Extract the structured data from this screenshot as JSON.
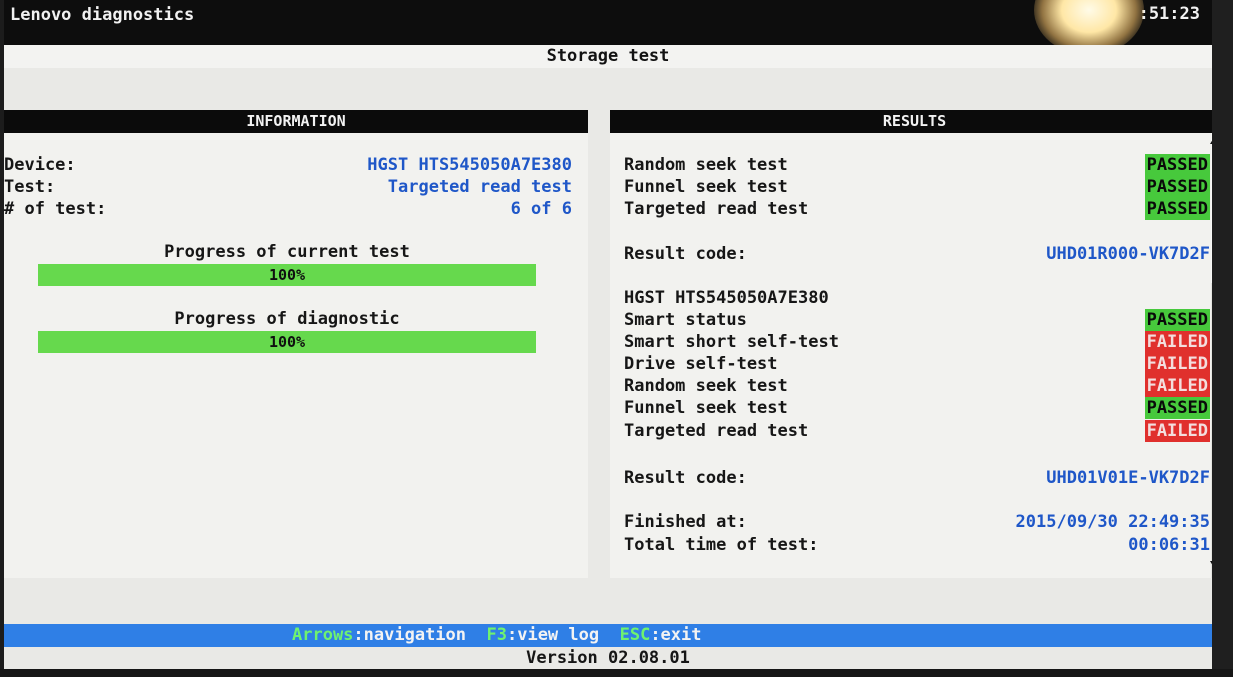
{
  "app": {
    "title": "Lenovo diagnostics",
    "clock": ":51:23"
  },
  "screen": {
    "title": "Storage test"
  },
  "information": {
    "header": "INFORMATION",
    "rows": [
      {
        "label": "Device:",
        "value": "HGST HTS545050A7E380"
      },
      {
        "label": "Test:",
        "value": "Targeted read test"
      },
      {
        "label": "# of test:",
        "value": "6 of 6"
      }
    ],
    "progress_current": {
      "label": "Progress of current test",
      "text": "100%",
      "percent": 100
    },
    "progress_diagnostic": {
      "label": "Progress of diagnostic",
      "text": "100%",
      "percent": 100
    }
  },
  "results": {
    "header": "RESULTS",
    "group1": [
      {
        "label": "Random seek test",
        "status": "PASSED"
      },
      {
        "label": "Funnel seek test",
        "status": "PASSED"
      },
      {
        "label": "Targeted read test",
        "status": "PASSED"
      }
    ],
    "result_code_1": {
      "label": "Result code:",
      "value": "UHD01R000-VK7D2F"
    },
    "device_name": "HGST HTS545050A7E380",
    "group2": [
      {
        "label": "Smart status",
        "status": "PASSED"
      },
      {
        "label": "Smart short self-test",
        "status": "FAILED"
      },
      {
        "label": "Drive self-test",
        "status": "FAILED"
      },
      {
        "label": "Random seek test",
        "status": "FAILED"
      },
      {
        "label": "Funnel seek test",
        "status": "PASSED"
      },
      {
        "label": "Targeted read test",
        "status": "FAILED"
      }
    ],
    "result_code_2": {
      "label": "Result code:",
      "value": "UHD01V01E-VK7D2F"
    },
    "finished": {
      "label": "Finished at:",
      "value": "2015/09/30 22:49:35"
    },
    "total_time": {
      "label": "Total time of test:",
      "value": "00:06:31"
    }
  },
  "footer": {
    "arrows_key": "Arrows",
    "arrows_action": ":navigation",
    "f3_key": "F3",
    "f3_action": ":view log",
    "esc_key": "ESC",
    "esc_action": ":exit",
    "version": "Version 02.08.01"
  },
  "colors": {
    "pass": "#47c93c",
    "fail": "#e0302d",
    "value_blue": "#1f57c8",
    "footer_blue": "#2f7fe6",
    "progress_green": "#66d94d"
  }
}
